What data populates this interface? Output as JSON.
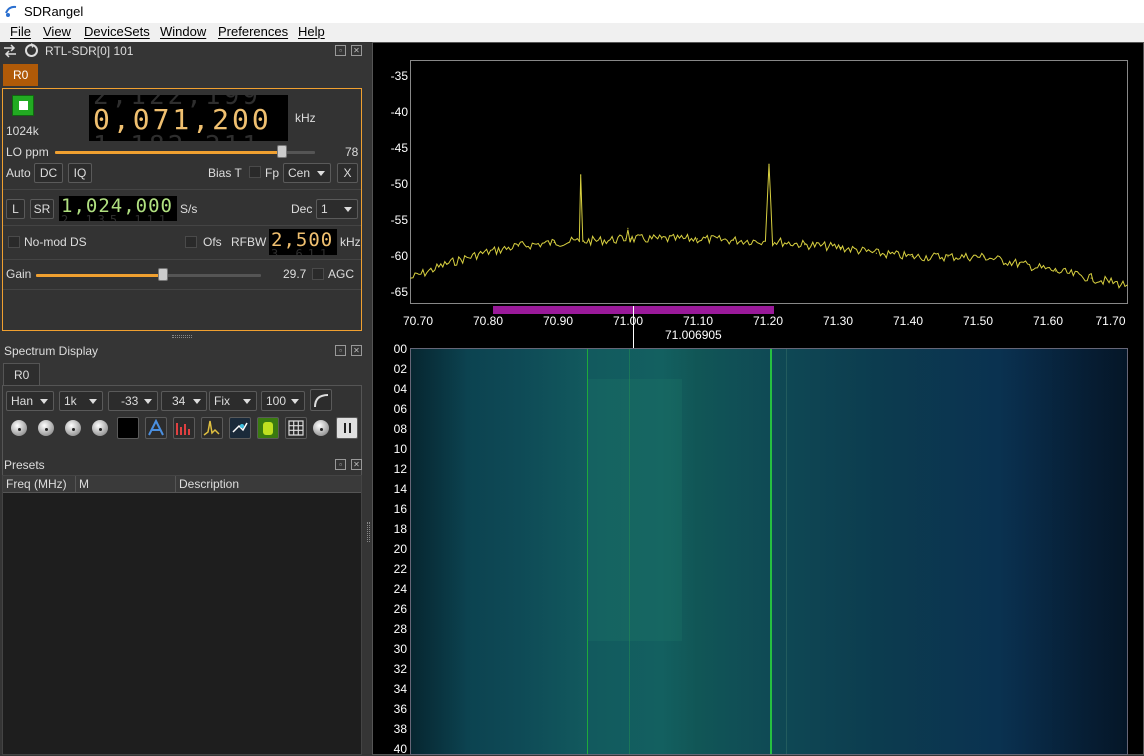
{
  "app": {
    "title": "SDRangel"
  },
  "menu": [
    "File",
    "View",
    "DeviceSets",
    "Window",
    "Preferences",
    "Help"
  ],
  "device": {
    "title": "RTL-SDR[0] 101",
    "tab": "R0",
    "sample_rate_short": "1024k",
    "center_freq": "0,071,200",
    "freq_unit": "kHz",
    "lo_ppm_label": "LO ppm",
    "lo_ppm_value": "78",
    "auto_label": "Auto",
    "dc_label": "DC",
    "iq_label": "IQ",
    "bias_t_label": "Bias T",
    "fp_label": "Fp",
    "fp_mode": "Cen",
    "x_label": "X",
    "l_label": "L",
    "sr_label": "SR",
    "sample_rate": "1,024,000",
    "sr_unit": "S/s",
    "dec_label": "Dec",
    "dec_value": "1",
    "nomod_label": "No-mod DS",
    "ofs_label": "Ofs",
    "rfbw_label": "RFBW",
    "rfbw_value": "2,500",
    "rfbw_unit": "kHz",
    "gain_label": "Gain",
    "gain_value": "29.7",
    "agc_label": "AGC"
  },
  "spectrum_display": {
    "title": "Spectrum Display",
    "tab": "R0",
    "window": "Han",
    "fft_size": "1k",
    "ref_level": "-33",
    "range": "34",
    "mode": "Fix",
    "avg": "100"
  },
  "presets": {
    "title": "Presets",
    "columns": [
      "Freq (MHz)",
      "M",
      "Description"
    ]
  },
  "spectrum": {
    "y_ticks": [
      "-35",
      "-40",
      "-45",
      "-50",
      "-55",
      "-60",
      "-65"
    ],
    "x_ticks": [
      "70.70",
      "70.80",
      "70.90",
      "71.00",
      "71.10",
      "71.20",
      "71.30",
      "71.40",
      "71.50",
      "71.60",
      "71.70"
    ],
    "cursor_freq": "71.006905",
    "trace_color": "#d8d040",
    "channel_color": "#9a1a9a"
  },
  "waterfall": {
    "time_ticks": [
      "00",
      "02",
      "04",
      "06",
      "08",
      "10",
      "12",
      "14",
      "16",
      "18",
      "20",
      "22",
      "24",
      "26",
      "28",
      "30",
      "32",
      "34",
      "36",
      "38",
      "40"
    ]
  },
  "chart_data": {
    "type": "line",
    "x_range": [
      70.7,
      71.7
    ],
    "ylim": [
      -67,
      -33
    ],
    "series": [
      {
        "x": [
          70.7,
          70.75,
          70.8,
          70.85,
          70.9,
          70.935,
          70.937,
          70.94,
          70.97,
          71.0,
          71.003,
          71.006,
          71.05,
          71.1,
          71.15,
          71.195,
          71.2,
          71.205,
          71.25,
          71.3,
          71.35,
          71.4,
          71.45,
          71.5,
          71.55,
          71.6,
          71.65,
          71.7
        ],
        "values": [
          -63.5,
          -61.5,
          -60,
          -59,
          -58.5,
          -58.3,
          -49,
          -58.3,
          -58.2,
          -58,
          -56.5,
          -58,
          -58,
          -58,
          -58.2,
          -58.3,
          -47.5,
          -58.3,
          -58.8,
          -59.2,
          -60,
          -60.5,
          -60.5,
          -60.5,
          -61.5,
          -62.5,
          -63.5,
          -64.5
        ]
      }
    ]
  }
}
